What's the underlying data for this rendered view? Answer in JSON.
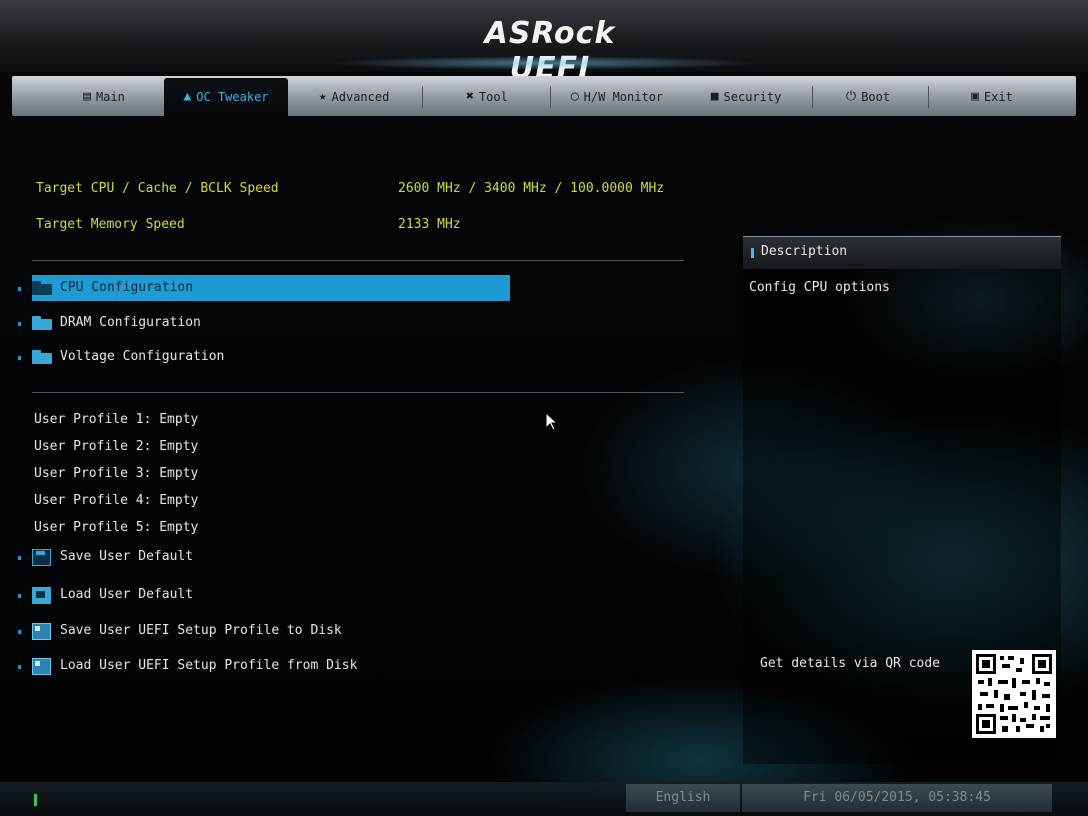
{
  "app": {
    "title": "ASRock UEFI"
  },
  "tabs": [
    {
      "label": "Main",
      "icon": "list-icon"
    },
    {
      "label": "OC Tweaker",
      "icon": "flame-icon",
      "active": true
    },
    {
      "label": "Advanced",
      "icon": "star-icon"
    },
    {
      "label": "Tool",
      "icon": "tools-icon"
    },
    {
      "label": "H/W Monitor",
      "icon": "monitor-ring-icon"
    },
    {
      "label": "Security",
      "icon": "shield-icon"
    },
    {
      "label": "Boot",
      "icon": "power-icon"
    },
    {
      "label": "Exit",
      "icon": "exit-icon"
    }
  ],
  "info": {
    "cpu_label": "Target CPU / Cache / BCLK Speed",
    "cpu_value": "2600 MHz / 3400 MHz / 100.0000 MHz",
    "mem_label": "Target Memory Speed",
    "mem_value": "2133 MHz"
  },
  "config_items": [
    {
      "label": "CPU Configuration",
      "icon": "folder-icon",
      "selected": true
    },
    {
      "label": "DRAM Configuration",
      "icon": "folder-icon"
    },
    {
      "label": "Voltage Configuration",
      "icon": "folder-icon"
    }
  ],
  "profiles": [
    "User Profile 1: Empty",
    "User Profile 2: Empty",
    "User Profile 3: Empty",
    "User Profile 4: Empty",
    "User Profile 5: Empty"
  ],
  "actions": [
    {
      "label": "Save User Default",
      "icon": "save-icon"
    },
    {
      "label": "Load User Default",
      "icon": "load-icon"
    },
    {
      "label": "Save User UEFI Setup Profile to Disk",
      "icon": "disk-icon"
    },
    {
      "label": "Load User UEFI Setup Profile from Disk",
      "icon": "disk-icon"
    }
  ],
  "description": {
    "title": "Description",
    "text": "Config CPU options",
    "qr_label": "Get details via QR code"
  },
  "footer": {
    "language": "English",
    "datetime": "Fri 06/05/2015, 05:38:45"
  },
  "colors": {
    "accent": "#1f9bd4",
    "yellow_text": "#d6d838"
  }
}
